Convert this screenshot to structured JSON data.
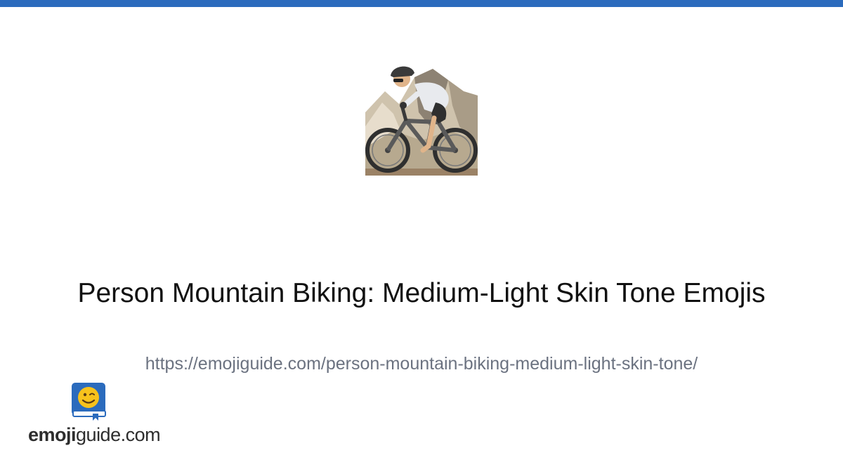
{
  "colors": {
    "accent_bar": "#2b6bbd",
    "title": "#111111",
    "url": "#6b7280"
  },
  "hero": {
    "icon": "person-mountain-biking-medium-light-skin-tone-emoji"
  },
  "title": "Person Mountain Biking: Medium-Light Skin Tone Emojis",
  "url": "https://emojiguide.com/person-mountain-biking-medium-light-skin-tone/",
  "logo": {
    "icon": "winking-face-book-icon",
    "text_bold": "emoji",
    "text_regular": "guide.com"
  }
}
